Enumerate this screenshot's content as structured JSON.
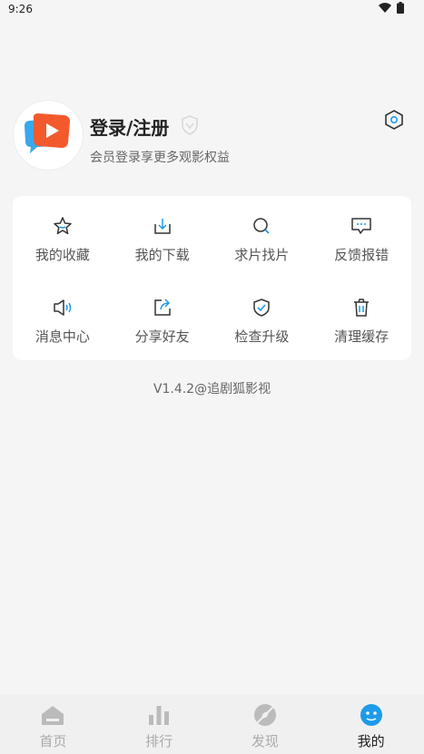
{
  "status": {
    "time": "9:26"
  },
  "profile": {
    "title": "登录/注册",
    "subtitle": "会员登录享更多观影权益"
  },
  "menu": [
    {
      "label": "我的收藏",
      "icon": "star-icon"
    },
    {
      "label": "我的下载",
      "icon": "download-icon"
    },
    {
      "label": "求片找片",
      "icon": "search-icon"
    },
    {
      "label": "反馈报错",
      "icon": "feedback-icon"
    },
    {
      "label": "消息中心",
      "icon": "speaker-icon"
    },
    {
      "label": "分享好友",
      "icon": "share-icon"
    },
    {
      "label": "检查升级",
      "icon": "shield-check-icon"
    },
    {
      "label": "清理缓存",
      "icon": "trash-icon"
    }
  ],
  "version": "V1.4.2@追剧狐影视",
  "tabs": [
    {
      "label": "首页",
      "icon": "home-icon",
      "active": false
    },
    {
      "label": "排行",
      "icon": "ranking-icon",
      "active": false
    },
    {
      "label": "发现",
      "icon": "discover-icon",
      "active": false
    },
    {
      "label": "我的",
      "icon": "mine-icon",
      "active": true
    }
  ],
  "colors": {
    "accent": "#1e9be8",
    "icon": "#333333",
    "inactive": "#aaaaaa",
    "background": "#f5f5f5"
  }
}
